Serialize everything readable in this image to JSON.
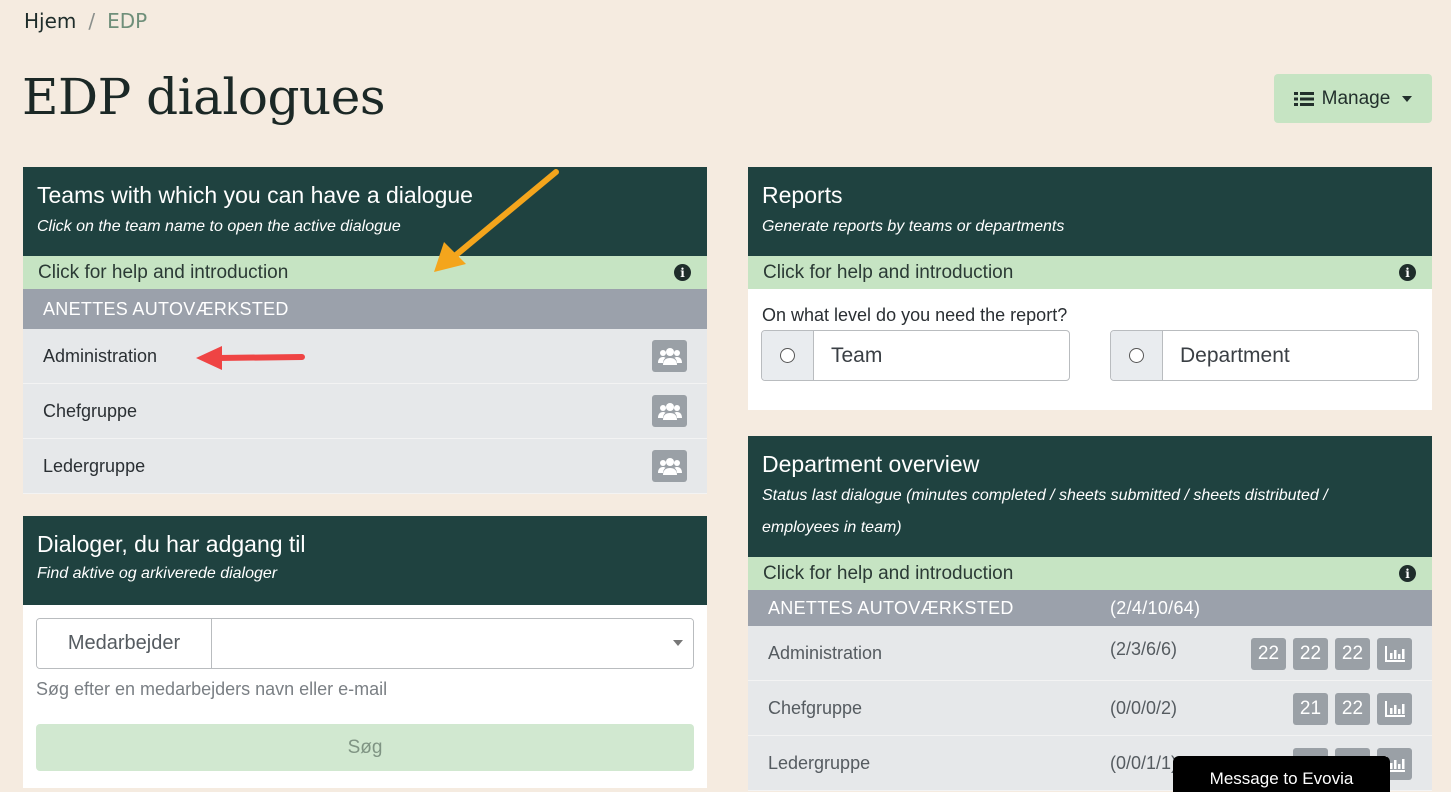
{
  "breadcrumb": {
    "home": "Hjem",
    "separator": "/",
    "current": "EDP"
  },
  "page": {
    "title": "EDP dialogues"
  },
  "manage": {
    "label": "Manage"
  },
  "teams_card": {
    "title": "Teams with which you can have a dialogue",
    "subtitle": "Click on the team name to open the active dialogue",
    "help": "Click for help and introduction",
    "group": "ANETTES AUTOVÆRKSTED",
    "teams": [
      {
        "name": "Administration"
      },
      {
        "name": "Chefgruppe"
      },
      {
        "name": "Ledergruppe"
      }
    ]
  },
  "dialogs_card": {
    "title": "Dialoger, du har adgang til",
    "subtitle": "Find aktive og arkiverede dialoger",
    "input_label": "Medarbejder",
    "hint": "Søg efter en medarbejders navn eller e-mail",
    "search_button": "Søg"
  },
  "reports_card": {
    "title": "Reports",
    "subtitle": "Generate reports by teams or departments",
    "help": "Click for help and introduction",
    "question": "On what level do you need the report?",
    "options": [
      {
        "label": "Team"
      },
      {
        "label": "Department"
      }
    ]
  },
  "dept_card": {
    "title": "Department overview",
    "subtitle": "Status last dialogue (minutes completed / sheets submitted / sheets distributed / employees in team)",
    "help": "Click for help and introduction",
    "group": {
      "name": "ANETTES AUTOVÆRKSTED",
      "stat": "(2/4/10/64)"
    },
    "rows": [
      {
        "name": "Administration",
        "stat": "(2/3/6/6)",
        "badges": [
          "22",
          "22",
          "22"
        ]
      },
      {
        "name": "Chefgruppe",
        "stat": "(0/0/0/2)",
        "badges": [
          "21",
          "22"
        ]
      },
      {
        "name": "Ledergruppe",
        "stat": "(0/0/1/1)",
        "badges": [
          "",
          ""
        ]
      }
    ]
  },
  "message": {
    "label": "Message to Evovia"
  },
  "colors": {
    "header": "#1f4240",
    "help": "#c6e4c3",
    "group": "#9ba1ab",
    "background": "#f5ebe0"
  }
}
